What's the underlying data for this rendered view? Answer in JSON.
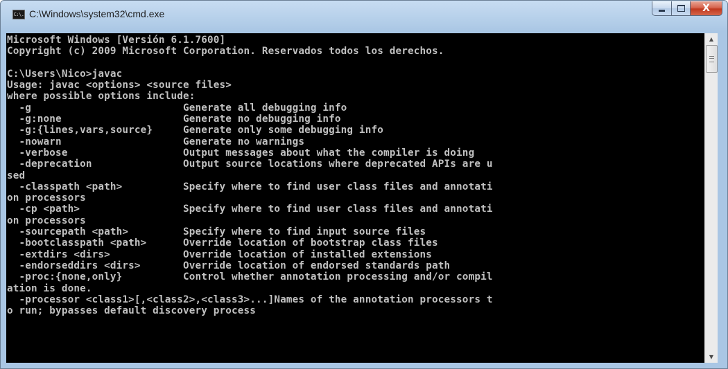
{
  "window": {
    "title": "C:\\Windows\\system32\\cmd.exe",
    "icon": "cmd-icon",
    "icon_text": "C:\\."
  },
  "controls": {
    "minimize": "minimize-icon",
    "maximize": "maximize-icon",
    "close": "close-icon",
    "close_glyph": "X"
  },
  "console": {
    "background": "#000000",
    "foreground": "#c0c0c0",
    "lines": [
      "Microsoft Windows [Versión 6.1.7600]",
      "Copyright (c) 2009 Microsoft Corporation. Reservados todos los derechos.",
      "",
      "C:\\Users\\Nico>javac",
      "Usage: javac <options> <source files>",
      "where possible options include:",
      "  -g                         Generate all debugging info",
      "  -g:none                    Generate no debugging info",
      "  -g:{lines,vars,source}     Generate only some debugging info",
      "  -nowarn                    Generate no warnings",
      "  -verbose                   Output messages about what the compiler is doing",
      "  -deprecation               Output source locations where deprecated APIs are u",
      "sed",
      "  -classpath <path>          Specify where to find user class files and annotati",
      "on processors",
      "  -cp <path>                 Specify where to find user class files and annotati",
      "on processors",
      "  -sourcepath <path>         Specify where to find input source files",
      "  -bootclasspath <path>      Override location of bootstrap class files",
      "  -extdirs <dirs>            Override location of installed extensions",
      "  -endorseddirs <dirs>       Override location of endorsed standards path",
      "  -proc:{none,only}          Control whether annotation processing and/or compil",
      "ation is done.",
      "  -processor <class1>[,<class2>,<class3>...]Names of the annotation processors t",
      "o run; bypasses default discovery process"
    ]
  },
  "scrollbar": {
    "up_icon": "scroll-up-arrow-icon",
    "down_icon": "scroll-down-arrow-icon",
    "up_glyph": "▲",
    "down_glyph": "▼"
  }
}
